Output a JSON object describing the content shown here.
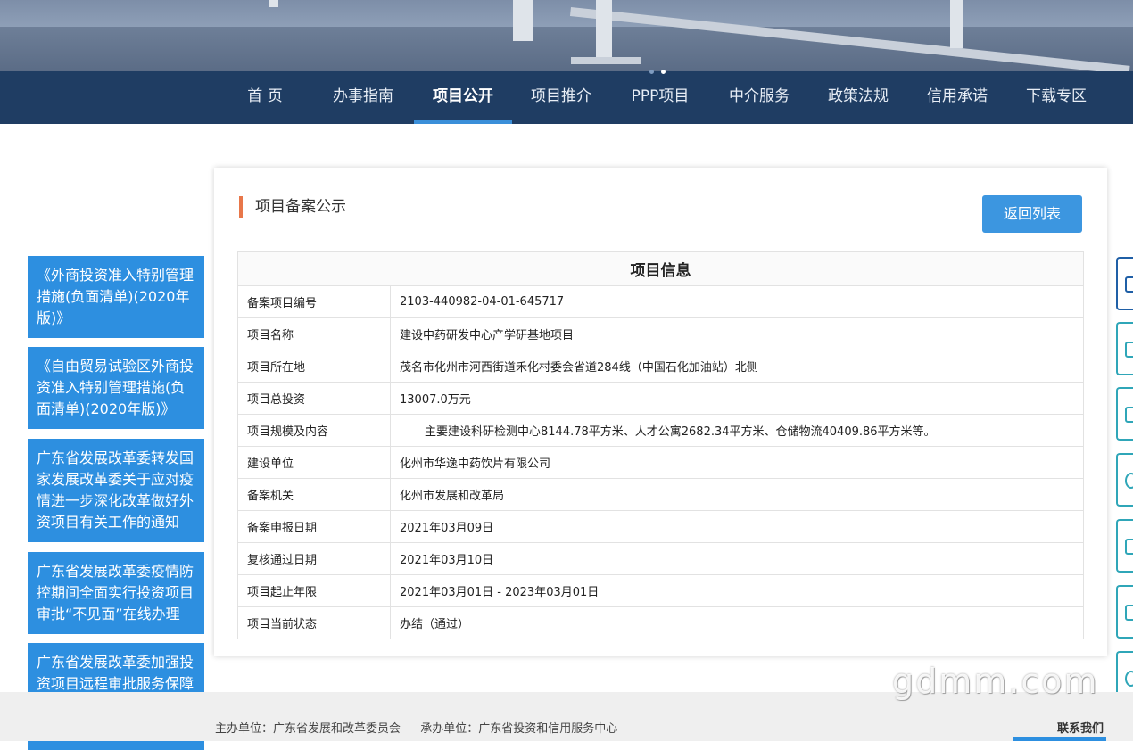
{
  "nav": {
    "items": [
      "首 页",
      "办事指南",
      "项目公开",
      "项目推介",
      "PPP项目",
      "中介服务",
      "政策法规",
      "信用承诺",
      "下载专区"
    ],
    "active": "项目公开"
  },
  "sidebar": {
    "items": [
      "《外商投资准入特别管理措施(负面清单)(2020年版)》",
      "《自由贸易试验区外商投资准入特别管理措施(负面清单)(2020年版)》",
      "广东省发展改革委转发国家发展改革委关于应对疫情进一步深化改革做好外资项目有关工作的通知",
      "广东省发展改革委疫情防控期间全面实行投资项目审批“不见面”在线办理",
      "广东省发展改革委加强投资项目远程审批服务保障疫情防控期间项目办理不断档"
    ]
  },
  "panel": {
    "title": "项目备案公示",
    "back_button": "返回列表",
    "table_title": "项目信息",
    "rows": [
      {
        "label": "备案项目编号",
        "value": "2103-440982-04-01-645717"
      },
      {
        "label": "项目名称",
        "value": "建设中药研发中心产学研基地项目"
      },
      {
        "label": "项目所在地",
        "value": "茂名市化州市河西街道禾化村委会省道284线（中国石化加油站）北侧"
      },
      {
        "label": "项目总投资",
        "value": "13007.0万元"
      },
      {
        "label": "项目规模及内容",
        "value": "主要建设科研检测中心8144.78平方米、人才公寓2682.34平方米、仓储物流40409.86平方米等。"
      },
      {
        "label": "建设单位",
        "value": "化州市华逸中药饮片有限公司"
      },
      {
        "label": "备案机关",
        "value": "化州市发展和改革局"
      },
      {
        "label": "备案申报日期",
        "value": "2021年03月09日"
      },
      {
        "label": "复核通过日期",
        "value": "2021年03月10日"
      },
      {
        "label": "项目起止年限",
        "value": "2021年03月01日 - 2023年03月01日"
      },
      {
        "label": "项目当前状态",
        "value": "办结（通过）"
      }
    ]
  },
  "footer": {
    "sponsor": "主办单位：广东省发展和改革委员会",
    "organizer": "承办单位：广东省投资和信用服务中心",
    "contact": "联系我们"
  },
  "watermark": "gdmm.com",
  "colors": {
    "nav_bg": "#1f3d63",
    "accent": "#2d8fe0",
    "title_marker": "#e8774a"
  }
}
